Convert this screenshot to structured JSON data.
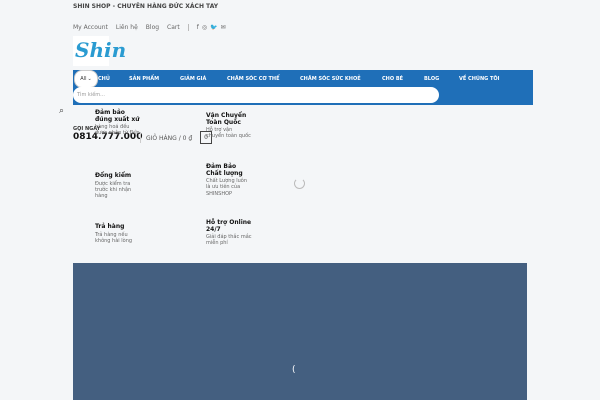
{
  "site": {
    "tagline": "SHIN SHOP - CHUYÊN HÀNG ĐỨC XÁCH TAY",
    "logo_text": "Shin"
  },
  "toplinks": [
    "My Account",
    "Liên hệ",
    "Blog",
    "Cart"
  ],
  "socials": [
    "facebook-icon",
    "instagram-icon",
    "twitter-icon",
    "email-icon"
  ],
  "search": {
    "category": "All",
    "placeholder": "Tìm kiếm..."
  },
  "nav": [
    "CHỦ",
    "SẢN PHẨM",
    "GIẢM GIÁ",
    "CHĂM SÓC CƠ THỂ",
    "CHĂM SÓC SỨC KHOẺ",
    "CHO BÉ",
    "BLOG",
    "VỀ CHÚNG TÔI"
  ],
  "contact": {
    "label": "GỌI NGAY",
    "phone": "0814.777.000"
  },
  "cart": {
    "label": "GIỎ HÀNG / 0 ₫",
    "count": "0"
  },
  "features": [
    {
      "title": "Đảm bảo đúng xuất xứ",
      "desc": "hàng hoá đều được nhập từ Đức"
    },
    {
      "title": "Đổng kiểm",
      "desc": "Được kiểm tra trước khi nhận hàng"
    },
    {
      "title": "Trả hàng",
      "desc": "Trả hàng nếu không hài lòng"
    },
    {
      "title": "Vận Chuyển Toàn Quốc",
      "desc": "Hỗ trợ vận chuyển toàn quốc"
    },
    {
      "title": "Đảm Bảo Chất lượng",
      "desc": "Chất Lượng luôn là ưu tiên của SHINSHOP"
    },
    {
      "title": "Hỗ trợ Online 24/7",
      "desc": "Giải đáp thắc mắc miễn phí"
    }
  ],
  "hero": {
    "loading": "("
  }
}
